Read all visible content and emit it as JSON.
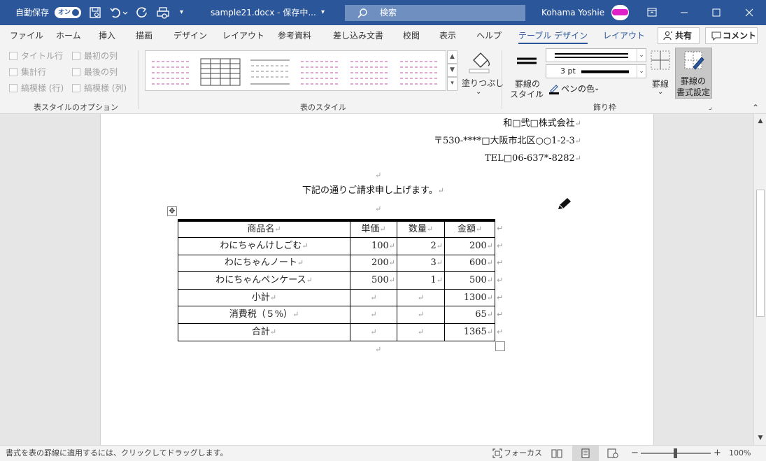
{
  "titlebar": {
    "autosave_label": "自動保存",
    "autosave_state": "オン",
    "doc_title": "sample21.docx - 保存中...",
    "doc_title_arrow": "▾",
    "search_placeholder": "検索",
    "user_name": "Kohama Yoshie",
    "qat_more": "▾"
  },
  "tabs": [
    "ファイル",
    "ホーム",
    "挿入",
    "描画",
    "デザイン",
    "レイアウト",
    "参考資料",
    "差し込み文書",
    "校閲",
    "表示",
    "ヘルプ"
  ],
  "context_tabs": {
    "table_design": "テーブル デザイン",
    "table_layout": "レイアウト"
  },
  "share": {
    "share_label": "共有",
    "comment_label": "コメント"
  },
  "style_options": {
    "items": [
      "タイトル行",
      "最初の列",
      "集計行",
      "最後の列",
      "縞模様 (行)",
      "縞模様 (列)"
    ],
    "group_label": "表スタイルのオプション"
  },
  "table_styles": {
    "group_label": "表のスタイル",
    "shading_label": "塗りつぶし",
    "shading_arrow": "⌄",
    "scroll_up": "▲",
    "scroll_down": "▼",
    "scroll_more": "▾"
  },
  "borders": {
    "group_label": "飾り枠",
    "border_style_label1": "罫線の",
    "border_style_label2": "スタイル",
    "border_style_arrow": "⌄",
    "pen_weight": "3 pt",
    "pen_color_label": "ペンの色",
    "pen_color_arrow": "⌄",
    "borders_label": "罫線",
    "borders_arrow": "⌄",
    "border_painter_label1": "罫線の",
    "border_painter_label2": "書式設定",
    "dd_arrow": "⌄",
    "launcher": "⌟",
    "collapse": "⌃",
    "pen_color": "#000000"
  },
  "document": {
    "company": "和□弐□株式会社",
    "address": "〒530-****□大阪市北区○○1-2-3",
    "tel": "TEL□06-637*-8282",
    "intro": "下記の通りご請求申し上げます。",
    "para_mark": "↵",
    "cell_mark": "↵",
    "table_move_icon": "✥",
    "table": {
      "headers": [
        "商品名",
        "単価",
        "数量",
        "金額"
      ],
      "rows": [
        [
          "わにちゃんけしごむ",
          "100",
          "2",
          "200"
        ],
        [
          "わにちゃんノート",
          "200",
          "3",
          "600"
        ],
        [
          "わにちゃんペンケース",
          "500",
          "1",
          "500"
        ],
        [
          "小計",
          "",
          "",
          "1300"
        ],
        [
          "消費税（５%）",
          "",
          "",
          "65"
        ],
        [
          "合計",
          "",
          "",
          "1365"
        ]
      ]
    }
  },
  "scrollbar": {
    "up": "▲",
    "down": "▼"
  },
  "statusbar": {
    "hint": "書式を表の罫線に適用するには、クリックしてドラッグします。",
    "focus_label": "フォーカス",
    "zoom_minus": "−",
    "zoom_plus": "+",
    "zoom_level": "100%"
  },
  "colors": {
    "accent": "#2b579a",
    "ribbon_bg": "#f3f3f3",
    "page_bg": "#ffffff"
  }
}
